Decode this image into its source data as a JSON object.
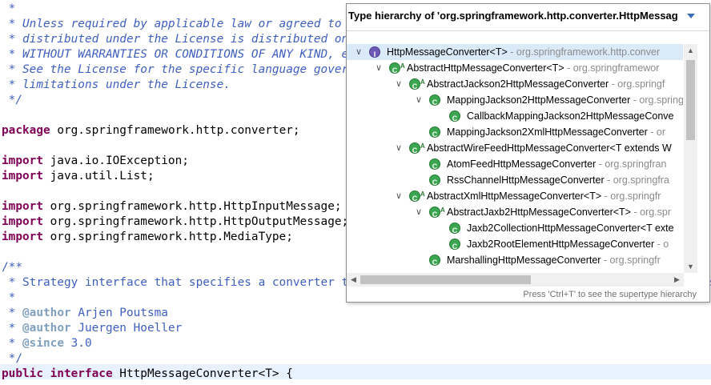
{
  "editor": {
    "lines": [
      {
        "cls": "comment",
        "text": " *"
      },
      {
        "cls": "comment",
        "text": " * Unless required by applicable law or agreed to in writing, software"
      },
      {
        "cls": "comment",
        "text": " * distributed under the License is distributed on an \"AS IS\" BASIS,"
      },
      {
        "cls": "comment",
        "text": " * WITHOUT WARRANTIES OR CONDITIONS OF ANY KIND, either express or implied."
      },
      {
        "cls": "comment",
        "text": " * See the License for the specific language governing permissions and"
      },
      {
        "cls": "comment",
        "text": " * limitations under the License."
      },
      {
        "cls": "comment",
        "text": " */"
      },
      {
        "cls": "plain",
        "text": ""
      },
      {
        "kw": "package",
        "rest": " org.springframework.http.converter;"
      },
      {
        "cls": "plain",
        "text": ""
      },
      {
        "kw": "import",
        "rest": " java.io.IOException;"
      },
      {
        "kw": "import",
        "rest": " java.util.List;"
      },
      {
        "cls": "plain",
        "text": ""
      },
      {
        "kw": "import",
        "rest": " org.springframework.http.HttpInputMessage;"
      },
      {
        "kw": "import",
        "rest": " org.springframework.http.HttpOutputMessage;"
      },
      {
        "kw": "import",
        "rest": " org.springframework.http.MediaType;"
      },
      {
        "cls": "plain",
        "text": ""
      },
      {
        "cls": "jdoc",
        "text": "/**"
      },
      {
        "cls": "jdoc",
        "text": " * Strategy interface that specifies a converter that can convert from and to HTTP requests and responses."
      },
      {
        "cls": "jdoc",
        "text": " *"
      },
      {
        "jtag": "@author",
        "prefix": " * ",
        "rest": " Arjen Poutsma"
      },
      {
        "jtag": "@author",
        "prefix": " * ",
        "rest": " Juergen Hoeller"
      },
      {
        "jtag": "@since",
        "prefix": " * ",
        "rest": " 3.0"
      },
      {
        "cls": "jdoc",
        "text": " */"
      },
      {
        "kw": "public interface",
        "rest": " HttpMessageConverter<T> {"
      }
    ]
  },
  "popup": {
    "title": "Type hierarchy of 'org.springframework.http.converter.HttpMessag",
    "status": "Press 'Ctrl+T' to see the supertype hierarchy",
    "rows": [
      {
        "name": "HttpMessageConverter<T>",
        "pkg": " - org.springframework.http.conver",
        "icon": "interface",
        "abstract": false,
        "twisty": true,
        "selected": true
      },
      {
        "name": "AbstractHttpMessageConverter<T>",
        "pkg": " - org.springframewor",
        "icon": "class",
        "abstract": true,
        "twisty": true,
        "selected": false
      },
      {
        "name": "AbstractJackson2HttpMessageConverter",
        "pkg": " - org.springf",
        "icon": "class",
        "abstract": true,
        "twisty": true,
        "selected": false
      },
      {
        "name": "MappingJackson2HttpMessageConverter",
        "pkg": " - org.spring",
        "icon": "class",
        "abstract": false,
        "twisty": true,
        "selected": false
      },
      {
        "name": "CallbackMappingJackson2HttpMessageConve",
        "pkg": "",
        "icon": "class",
        "abstract": false,
        "twisty": false,
        "selected": false
      },
      {
        "name": "MappingJackson2XmlHttpMessageConverter",
        "pkg": " - or",
        "icon": "class",
        "abstract": false,
        "twisty": false,
        "selected": false
      },
      {
        "name": "AbstractWireFeedHttpMessageConverter<T extends W",
        "pkg": "",
        "icon": "class",
        "abstract": true,
        "twisty": true,
        "selected": false
      },
      {
        "name": "AtomFeedHttpMessageConverter",
        "pkg": " - org.springfran",
        "icon": "class",
        "abstract": false,
        "twisty": false,
        "selected": false
      },
      {
        "name": "RssChannelHttpMessageConverter",
        "pkg": " - org.springfra",
        "icon": "class",
        "abstract": false,
        "twisty": false,
        "selected": false
      },
      {
        "name": "AbstractXmlHttpMessageConverter<T>",
        "pkg": " - org.springfr",
        "icon": "class",
        "abstract": true,
        "twisty": true,
        "selected": false
      },
      {
        "name": "AbstractJaxb2HttpMessageConverter<T>",
        "pkg": " - org.spr",
        "icon": "class",
        "abstract": true,
        "twisty": true,
        "selected": false
      },
      {
        "name": "Jaxb2CollectionHttpMessageConverter<T exte",
        "pkg": "",
        "icon": "class",
        "abstract": false,
        "twisty": false,
        "selected": false
      },
      {
        "name": "Jaxb2RootElementHttpMessageConverter",
        "pkg": " - o",
        "icon": "class",
        "abstract": false,
        "twisty": false,
        "selected": false
      },
      {
        "name": "MarshallingHttpMessageConverter",
        "pkg": " - org.springfr",
        "icon": "class",
        "abstract": false,
        "twisty": false,
        "selected": false
      }
    ]
  }
}
